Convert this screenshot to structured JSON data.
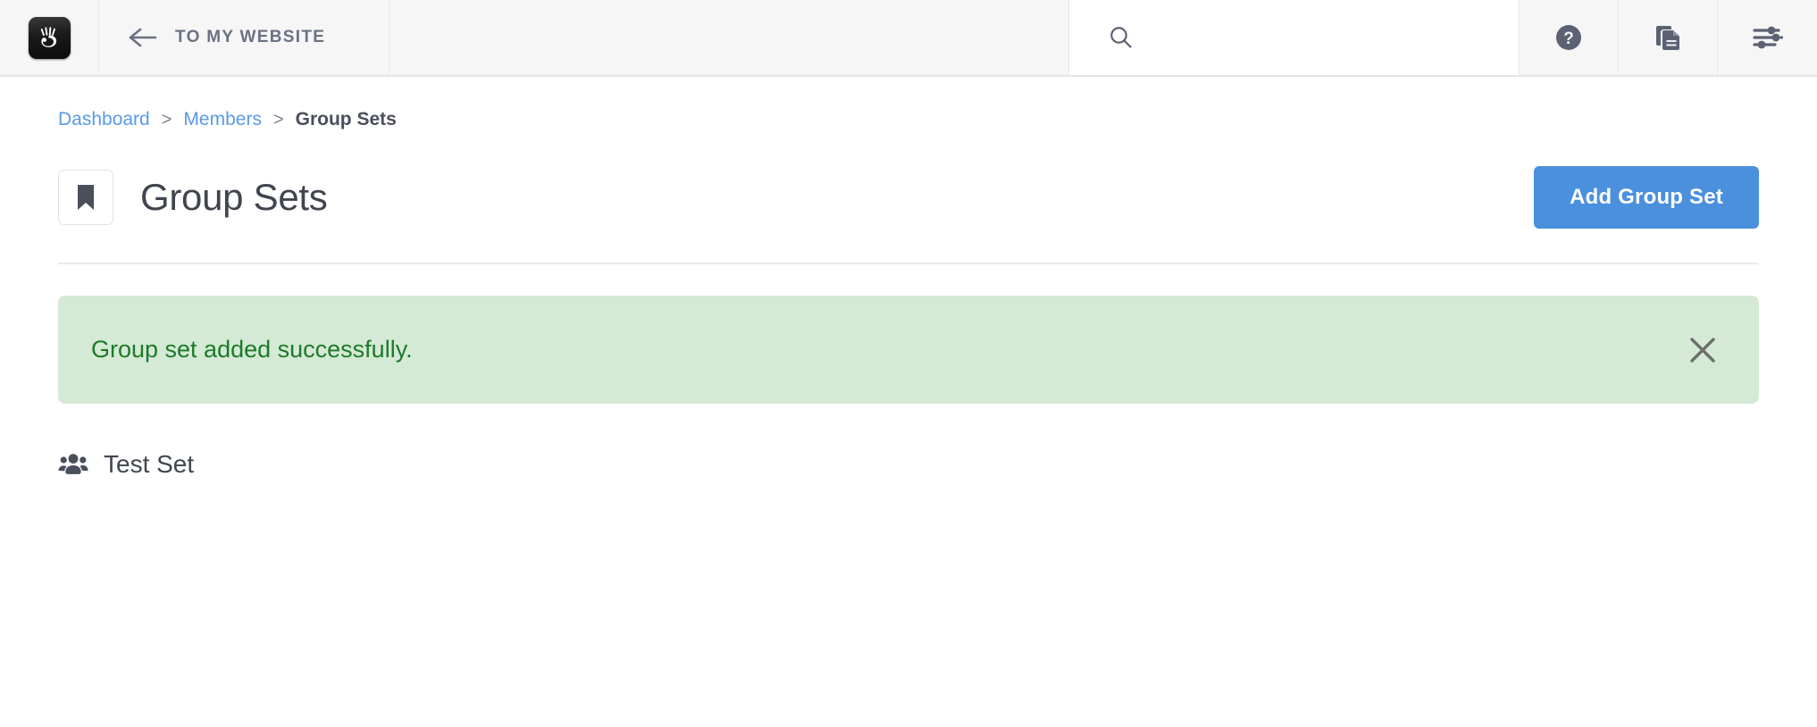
{
  "topbar": {
    "logo_icon": "concrete-hand-logo-icon",
    "back_arrow_icon": "arrow-left-icon",
    "to_site_label": "TO MY WEBSITE",
    "search": {
      "icon": "search-icon",
      "value": "",
      "placeholder": ""
    },
    "actions": [
      {
        "name": "help-button",
        "icon": "question-circle-icon"
      },
      {
        "name": "pages-button",
        "icon": "copy-pages-icon"
      },
      {
        "name": "settings-button",
        "icon": "sliders-icon"
      }
    ]
  },
  "breadcrumb": {
    "items": [
      {
        "label": "Dashboard",
        "current": false
      },
      {
        "label": "Members",
        "current": false
      },
      {
        "label": "Group Sets",
        "current": true
      }
    ],
    "separator": ">"
  },
  "page": {
    "icon": "bookmark-icon",
    "title": "Group Sets",
    "primary_action": "Add Group Set"
  },
  "alert": {
    "type": "success",
    "message": "Group set added successfully.",
    "close_icon": "close-x-icon",
    "background": "#d4ead5",
    "text_color": "#1d7a29"
  },
  "group_sets": {
    "items": [
      {
        "label": "Test Set",
        "icon": "users-group-icon"
      }
    ]
  },
  "colors": {
    "accent": "#4a90dd",
    "link": "#5a9ae8",
    "text": "#41454f",
    "muted": "#6a7183",
    "header_bg": "#f6f6f7",
    "border": "#e3e7ec"
  }
}
